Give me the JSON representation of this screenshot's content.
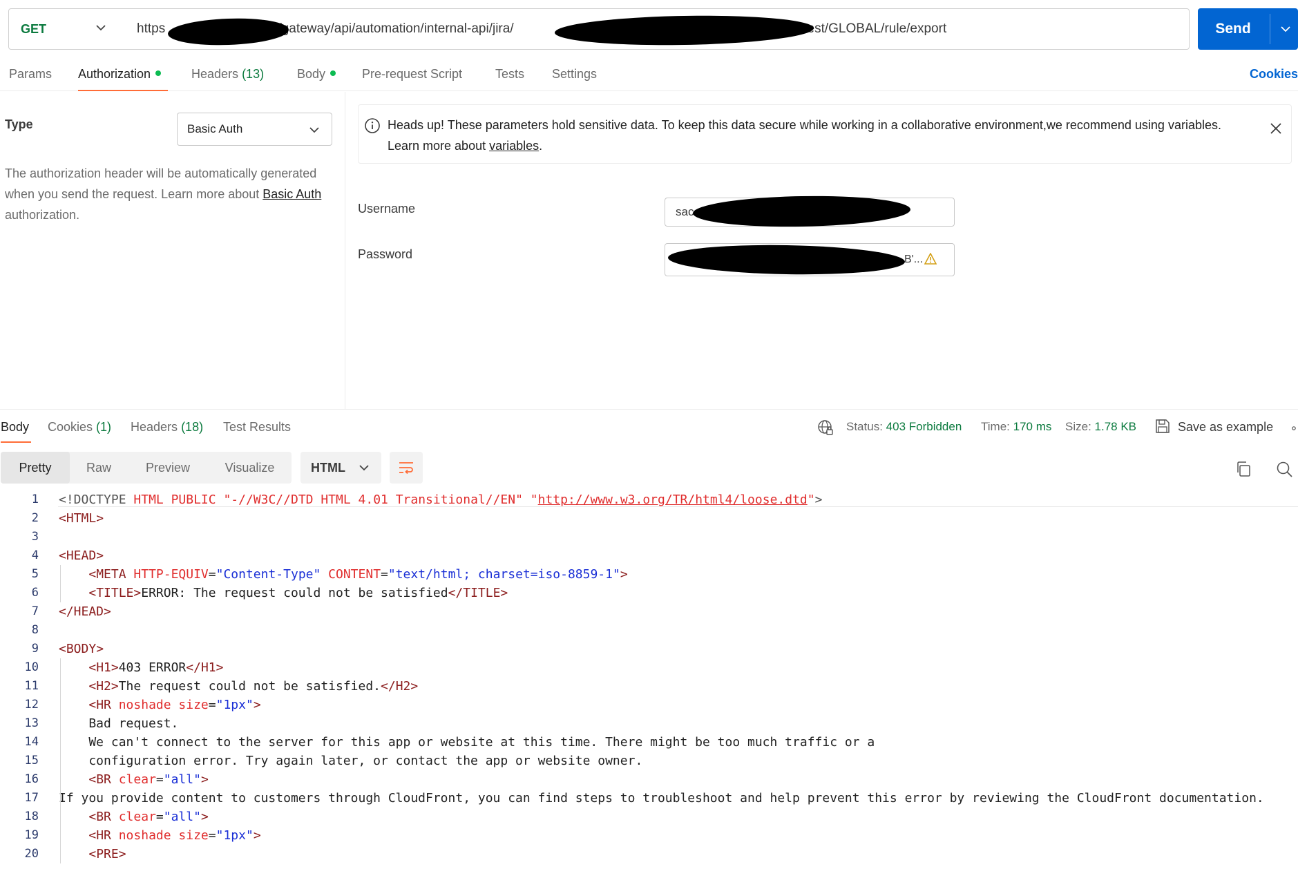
{
  "request": {
    "method": "GET",
    "url_start": "https",
    "url_mid": "n.net/gateway/api/automation/internal-api/jira/",
    "url_end": "7/pro/rest/GLOBAL/rule/export",
    "send_label": "Send"
  },
  "request_tabs": [
    {
      "label": "Params"
    },
    {
      "label": "Authorization"
    },
    {
      "label": "Headers",
      "count": "(13)"
    },
    {
      "label": "Body"
    },
    {
      "label": "Pre-request Script"
    },
    {
      "label": "Tests"
    },
    {
      "label": "Settings"
    }
  ],
  "cookies_link": "Cookies",
  "auth": {
    "type_label": "Type",
    "type_value": "Basic Auth",
    "desc_part1": "The authorization header will be automatically generated when you send the request. Learn more about ",
    "desc_link": "Basic Auth",
    "desc_part2": " authorization.",
    "alert_text": "Heads up! These parameters hold sensitive data. To keep this data secure while working in a collaborative environment,we recommend using variables. Learn more about ",
    "alert_link": "variables",
    "alert_end": ".",
    "username_label": "Username",
    "username_value": "sac",
    "password_label": "Password",
    "password_value": "B'..."
  },
  "response_tabs": [
    {
      "label": "Body"
    },
    {
      "label": "Cookies",
      "count": "(1)"
    },
    {
      "label": "Headers",
      "count": "(18)"
    },
    {
      "label": "Test Results"
    }
  ],
  "response_status": {
    "status_label": "Status:",
    "status_value": "403 Forbidden",
    "time_label": "Time:",
    "time_value": "170 ms",
    "size_label": "Size:",
    "size_value": "1.78 KB",
    "save_label": "Save as example"
  },
  "view_modes": [
    "Pretty",
    "Raw",
    "Preview",
    "Visualize"
  ],
  "language": "HTML",
  "code_lines": [
    {
      "n": "1",
      "text": "<!DOCTYPE HTML PUBLIC \"-//W3C//DTD HTML 4.01 Transitional//EN\" \"http://www.w3.org/TR/html4/loose.dtd\">"
    },
    {
      "n": "2",
      "text": "<HTML>"
    },
    {
      "n": "3",
      "text": ""
    },
    {
      "n": "4",
      "text": "<HEAD>"
    },
    {
      "n": "5",
      "text": "    <META HTTP-EQUIV=\"Content-Type\" CONTENT=\"text/html; charset=iso-8859-1\">"
    },
    {
      "n": "6",
      "text": "    <TITLE>ERROR: The request could not be satisfied</TITLE>"
    },
    {
      "n": "7",
      "text": "</HEAD>"
    },
    {
      "n": "8",
      "text": ""
    },
    {
      "n": "9",
      "text": "<BODY>"
    },
    {
      "n": "10",
      "text": "    <H1>403 ERROR</H1>"
    },
    {
      "n": "11",
      "text": "    <H2>The request could not be satisfied.</H2>"
    },
    {
      "n": "12",
      "text": "    <HR noshade size=\"1px\">"
    },
    {
      "n": "13",
      "text": "    Bad request."
    },
    {
      "n": "14",
      "text": "    We can't connect to the server for this app or website at this time. There might be too much traffic or a"
    },
    {
      "n": "15",
      "text": "    configuration error. Try again later, or contact the app or website owner."
    },
    {
      "n": "16",
      "text": "    <BR clear=\"all\">"
    },
    {
      "n": "17",
      "text": "If you provide content to customers through CloudFront, you can find steps to troubleshoot and help prevent this error by reviewing the CloudFront documentation."
    },
    {
      "n": "18",
      "text": "    <BR clear=\"all\">"
    },
    {
      "n": "19",
      "text": "    <HR noshade size=\"1px\">"
    },
    {
      "n": "20",
      "text": "    <PRE>"
    }
  ],
  "colors": {
    "accent": "#0265d2",
    "tab_indicator": "#ff6c37",
    "status_green": "#0b7a3e",
    "dot_green": "#0cbb52"
  },
  "icons": [
    "chevron-down-icon",
    "info-icon",
    "close-icon",
    "warning-icon",
    "globe-lock-icon",
    "save-icon",
    "copy-icon",
    "search-icon",
    "wrap-lines-icon"
  ]
}
